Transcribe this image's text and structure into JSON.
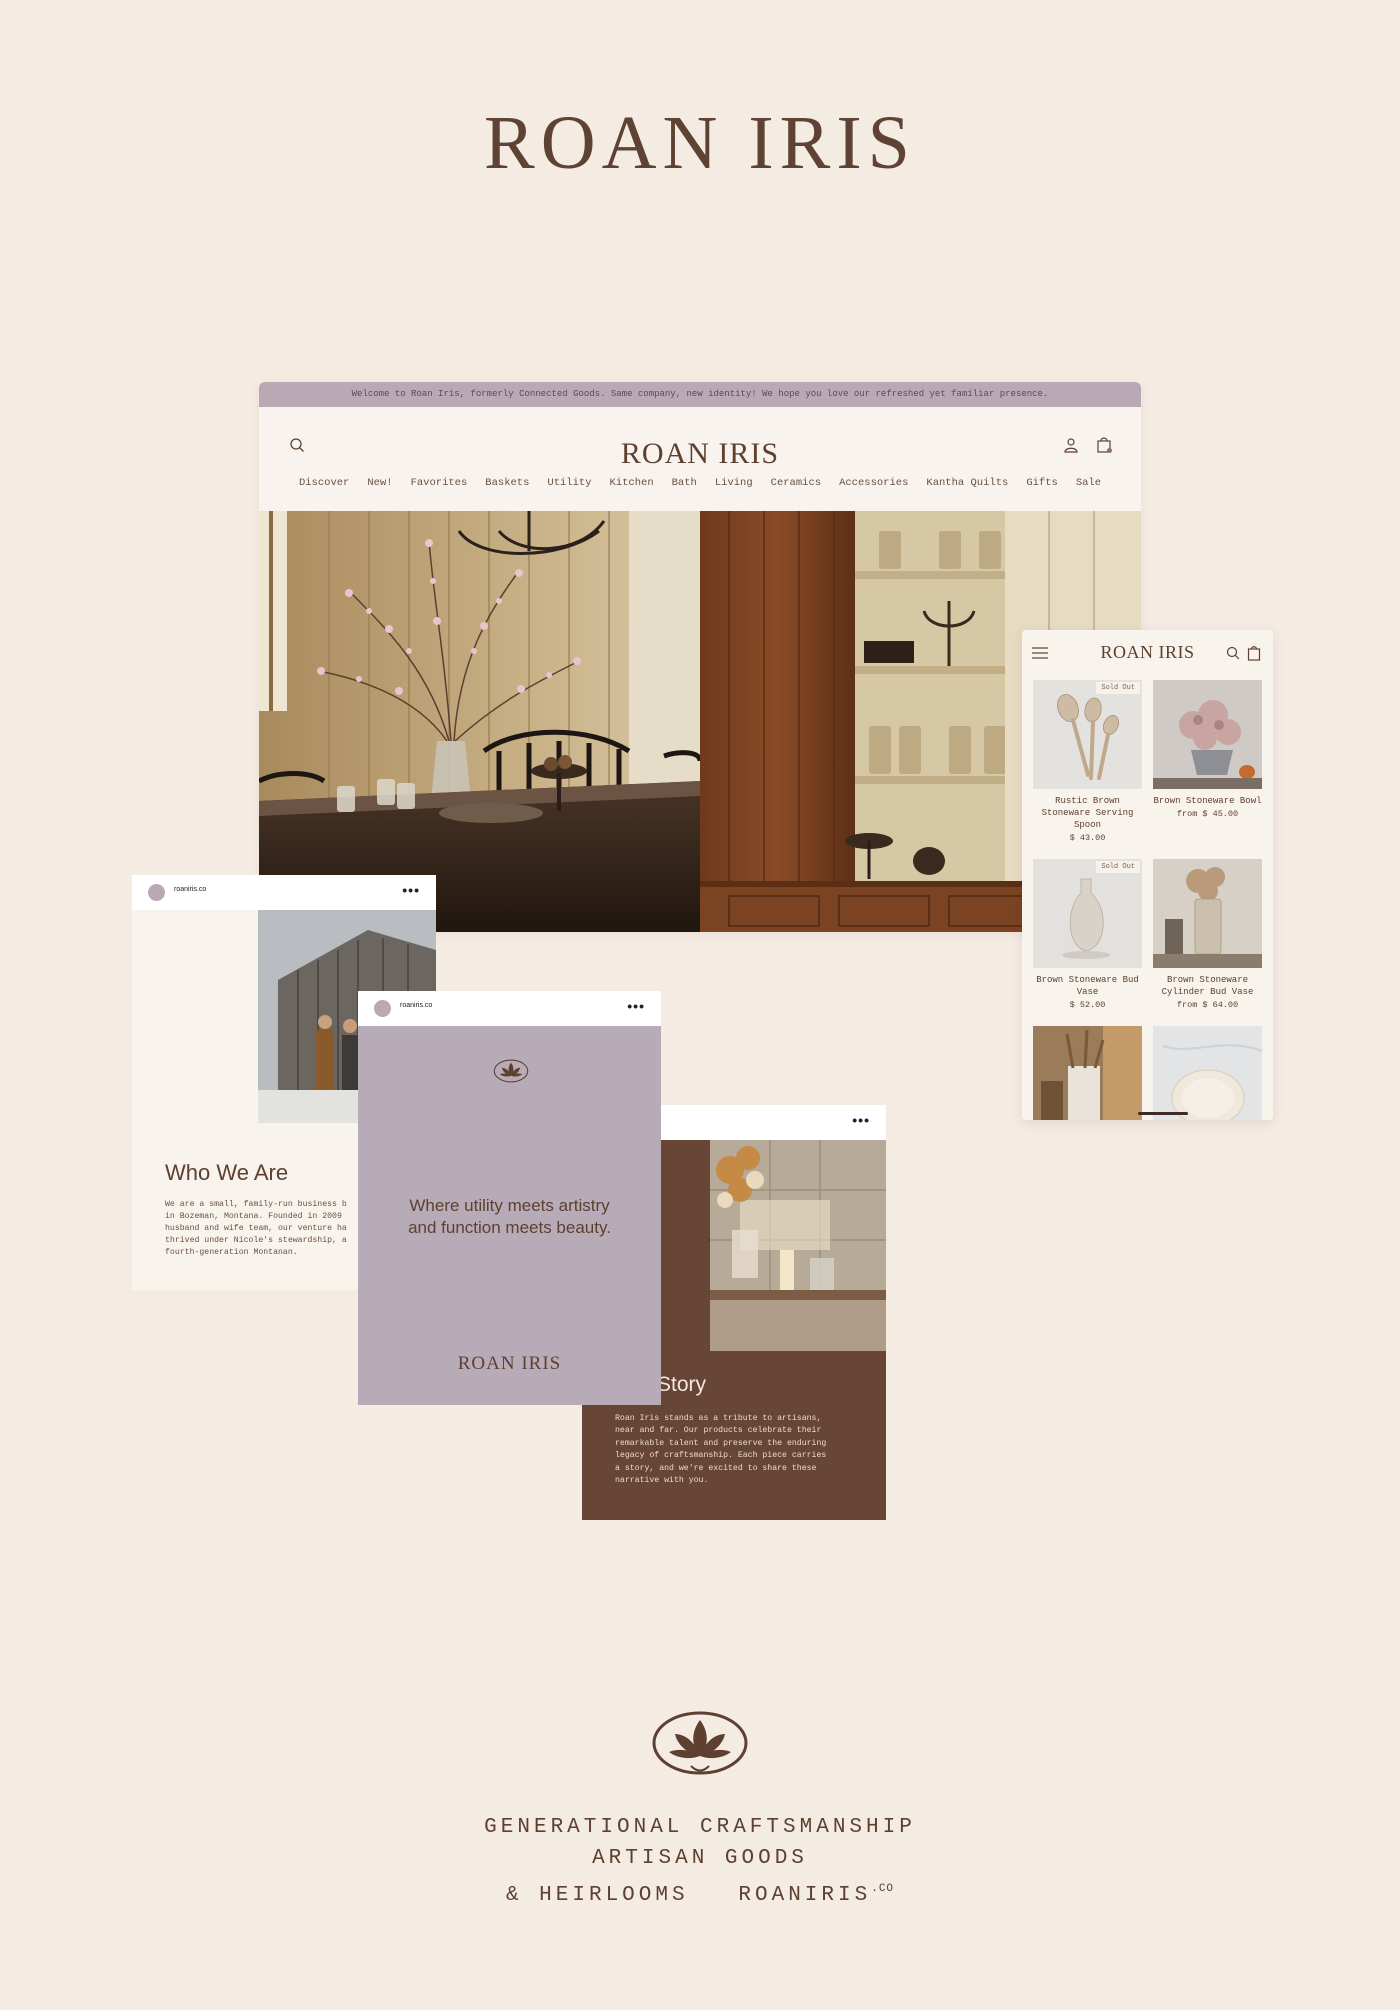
{
  "hero": {
    "title": "ROAN IRIS"
  },
  "desktop": {
    "banner": "Welcome to Roan Iris, formerly Connected Goods. Same company, new identity! We hope you love our refreshed yet familiar presence.",
    "logo": "ROAN IRIS",
    "nav": [
      "Discover",
      "New!",
      "Favorites",
      "Baskets",
      "Utility",
      "Kitchen",
      "Bath",
      "Living",
      "Ceramics",
      "Accessories",
      "Kantha Quilts",
      "Gifts",
      "Sale"
    ],
    "icons": [
      "search-icon",
      "account-icon",
      "cart-icon"
    ]
  },
  "mobile": {
    "logo": "ROAN IRIS",
    "icons": [
      "menu-icon",
      "search-icon",
      "bag-icon"
    ],
    "products": [
      {
        "name": "Rustic Brown Stoneware Serving Spoon",
        "price": "$ 43.00",
        "badge": "Sold Out"
      },
      {
        "name": "Brown Stoneware Bowl",
        "price": "from $ 45.00",
        "badge": ""
      },
      {
        "name": "Brown Stoneware Bud Vase",
        "price": "$ 52.00",
        "badge": "Sold Out"
      },
      {
        "name": "Brown Stoneware Cylinder Bud Vase",
        "price": "from $ 64.00",
        "badge": ""
      }
    ]
  },
  "posts": {
    "handle": "roaniris.co",
    "who": {
      "title": "Who We Are",
      "body": "We are a small, family-run business b\nin Bozeman, Montana. Founded in 2009\nhusband and wife team, our venture ha\nthrived under Nicole's stewardship, a\nfourth-generation Montanan."
    },
    "quote": {
      "text": "Where utility meets artistry\nand function meets beauty.",
      "logo": "ROAN IRIS"
    },
    "story": {
      "title": "Story",
      "body": "Roan Iris stands as a tribute to artisans,\nnear and far. Our products celebrate their\nremarkable talent and preserve the enduring\nlegacy of craftsmanship. Each piece carries\na story, and we're excited to share these\nnarrative with you."
    }
  },
  "footer": {
    "line1": "GENERATIONAL CRAFTSMANSHIP",
    "line2": "ARTISAN GOODS",
    "line3": "& HEIRLOOMS",
    "domain": "ROANIRIS",
    "domain_suffix": ".CO"
  },
  "colors": {
    "background": "#f4ebe3",
    "brand_brown": "#5d4030",
    "lavender": "#b8a9b5",
    "story_brown": "#674636"
  }
}
